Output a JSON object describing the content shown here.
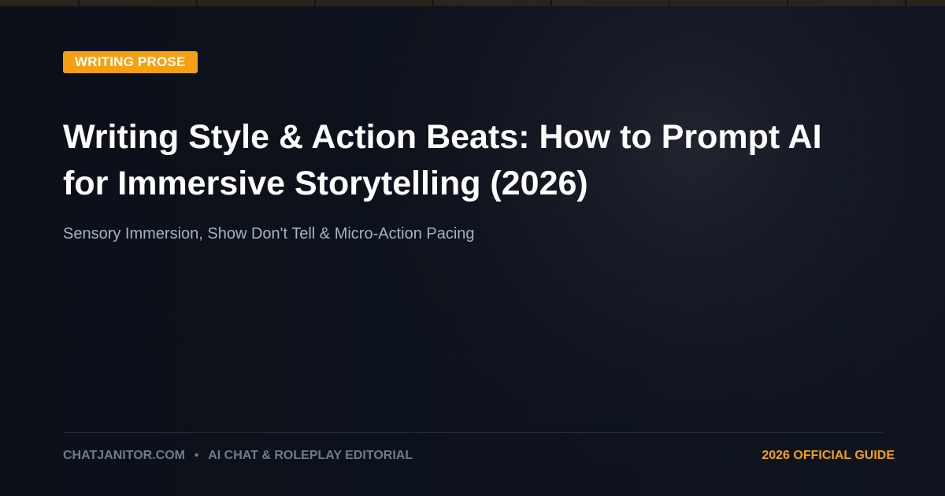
{
  "card": {
    "category_badge": "WRITING PROSE",
    "title": {
      "line1": "Writing Style & Action Beats: How to Prompt AI",
      "line2": "for Immersive Storytelling (2026)"
    },
    "subtitle": "Sensory Immersion, Show Don't Tell & Micro-Action Pacing",
    "footer": {
      "site": "CHATJANITOR.COM",
      "separator": "•",
      "section": "AI CHAT & ROLEPLAY EDITORIAL",
      "guide_label": "2026 OFFICIAL GUIDE"
    }
  },
  "colors": {
    "background": "#0c111b",
    "accent": "#f5a012",
    "title": "#ffffff",
    "subtitle": "#a9b1c5",
    "footer_text": "#727a90",
    "divider": "#262b3c"
  }
}
